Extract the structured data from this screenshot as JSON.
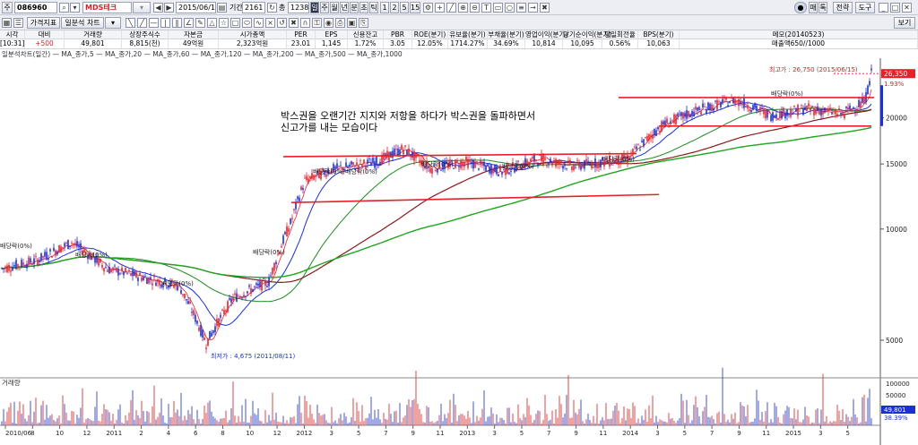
{
  "toolbar1": {
    "code_prefix": "주",
    "code": "086960",
    "stock_name": "MDS테크",
    "date": "2015/06/15",
    "period_label": "기간",
    "period_value": "2161",
    "count_label": "총",
    "count_value": "1238",
    "period_buttons": [
      "일",
      "주",
      "월",
      "년",
      "분",
      "초",
      "틱"
    ],
    "minute_buttons": [
      "1",
      "2",
      "5",
      "15"
    ],
    "right_buttons": [
      "매",
      "톡",
      "전략",
      "도구"
    ]
  },
  "toolbar2": {
    "tab1": "가격지표",
    "tab2": "일분석 차트",
    "right_button": "보기"
  },
  "info_headers": [
    "시각",
    "대비",
    "거래량",
    "상장주식수",
    "자본금",
    "시가총액",
    "PER",
    "EPS",
    "신용잔고",
    "PBR",
    "ROE(분기)",
    "유보율(분기)",
    "부채율(분기)",
    "영업이익(분기)",
    "당기순이익(분기)",
    "당일회전율",
    "BPS(분기)",
    "메모(20140523)"
  ],
  "info_values": [
    "[10:31]",
    "+500",
    "49,801",
    "8,815(천)",
    "49억원",
    "2,323억원",
    "23.01",
    "1,145",
    "1.72%",
    "3.05",
    "12.05%",
    "1714.27%",
    "34.69%",
    "10,814",
    "10,095",
    "0.56%",
    "10,063",
    "매출액650//1000"
  ],
  "legend_text": "일분석차트(일간) — MA_종가,5 — MA_종가,20 — MA_종가,60 — MA_종가,120 — MA_종가,200 — MA_종가,500 — MA_종가,1000",
  "annotation": {
    "line1": "박스권을 오랜기간 지지와 저항을 하다가 박스권을 돌파하면서",
    "line2": "신고가를 내는 모습이다"
  },
  "max_label": "최고가 : 26,750 (2015/06/15)",
  "min_label": "최저가 : 4,675 (2011/08/11)",
  "dividend_labels": [
    "배당락(0%)",
    "배당락(0%)",
    "배당락(0%)",
    "배당락(0%)",
    "배당락(0%)",
    "배당락(0%)",
    "배당락(0%)",
    "배당락(0%)",
    "배당락(0%)",
    "배당락(0%)"
  ],
  "price_axis": {
    "current": "26,350",
    "change": "1.93%",
    "ticks": [
      "20000",
      "15000",
      "10000",
      "5000"
    ]
  },
  "volume": {
    "title": "거래량",
    "ticks": [
      "100000",
      "50000"
    ],
    "current": "49,801",
    "pct": "38.39%"
  },
  "x_axis": [
    "2010/06",
    "8",
    "10",
    "12",
    "2011",
    "2",
    "4",
    "6",
    "8",
    "10",
    "12",
    "2012",
    "3",
    "5",
    "7",
    "9",
    "11",
    "2013",
    "3",
    "5",
    "7",
    "9",
    "11",
    "2014",
    "3",
    "5",
    "7",
    "9",
    "11",
    "2015",
    "3",
    "5"
  ],
  "colors": {
    "candle_up": "#e8202a",
    "candle_down": "#1a2fd6",
    "ma5": "#e8202a",
    "ma20": "#1a2fd6",
    "ma60": "#1c8a1c",
    "ma120": "#8b1a1a",
    "ma200": "#1fa51f",
    "box_line": "#e8202a",
    "current_price": "#e8202a"
  }
}
